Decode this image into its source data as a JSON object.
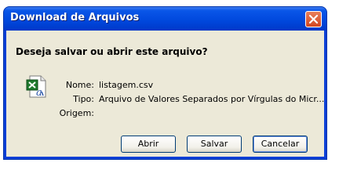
{
  "dialog": {
    "title": "Download de Arquivos",
    "question": "Deseja salvar ou abrir este arquivo?",
    "fields": {
      "name_label": "Nome:",
      "name_value": "listagem.csv",
      "type_label": "Tipo:",
      "type_value": "Arquivo de Valores Separados por Vírgulas do Micr...",
      "origin_label": "Origem:",
      "origin_value": ""
    },
    "file_icon": "excel-csv-file-icon",
    "buttons": {
      "open": "Abrir",
      "save": "Salvar",
      "cancel": "Cancelar"
    },
    "title_bar_color": "#0047dc",
    "close_button_color": "#d3461f",
    "client_bg": "#ece9d8"
  }
}
